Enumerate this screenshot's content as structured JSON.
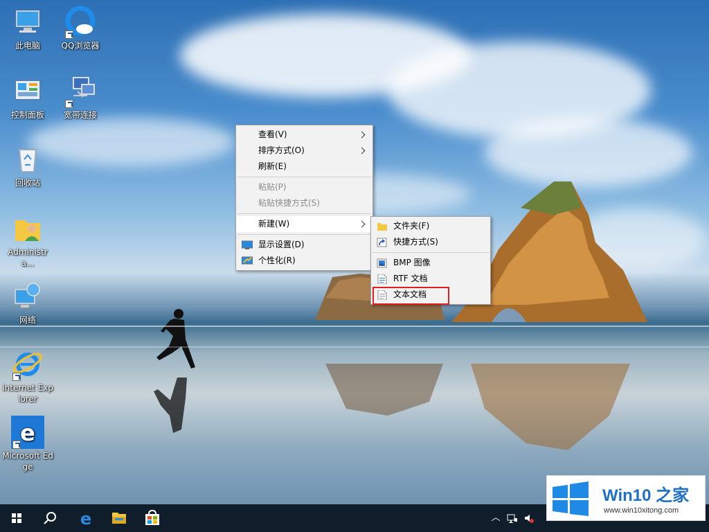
{
  "desktop": {
    "icons": [
      {
        "label": "此电脑",
        "icon": "this-pc-icon"
      },
      {
        "label": "QQ浏览器",
        "icon": "qq-browser-icon"
      },
      {
        "label": "控制面板",
        "icon": "control-panel-icon"
      },
      {
        "label": "宽带连接",
        "icon": "broadband-connection-icon"
      },
      {
        "label": "回收站",
        "icon": "recycle-bin-icon"
      },
      {
        "label": "Administra...",
        "icon": "user-folder-icon"
      },
      {
        "label": "网络",
        "icon": "network-icon"
      },
      {
        "label": "Internet Explorer",
        "icon": "internet-explorer-icon"
      },
      {
        "label": "Microsoft Edge",
        "icon": "edge-icon"
      }
    ]
  },
  "context_menu": {
    "items": [
      {
        "label": "查看(V)",
        "submenu": true
      },
      {
        "label": "排序方式(O)",
        "submenu": true
      },
      {
        "label": "刷新(E)"
      },
      {
        "label": "粘贴(P)",
        "disabled": true
      },
      {
        "label": "粘贴快捷方式(S)",
        "disabled": true
      },
      {
        "label": "新建(W)",
        "submenu": true,
        "active": true
      },
      {
        "label": "显示设置(D)",
        "icon": "display-settings-icon"
      },
      {
        "label": "个性化(R)",
        "icon": "personalize-icon"
      }
    ]
  },
  "new_submenu": {
    "items": [
      {
        "label": "文件夹(F)",
        "icon": "folder-icon"
      },
      {
        "label": "快捷方式(S)",
        "icon": "shortcut-icon"
      },
      {
        "label": "BMP 图像",
        "icon": "bmp-image-icon"
      },
      {
        "label": "RTF 文档",
        "icon": "rtf-document-icon"
      },
      {
        "label": "文本文档",
        "icon": "text-document-icon",
        "highlighted": true
      }
    ]
  },
  "taskbar": {
    "buttons": [
      "windows-start-icon",
      "search-icon",
      "edge-icon",
      "file-explorer-icon",
      "store-icon"
    ]
  },
  "watermark": {
    "title": "Win10 之家",
    "url": "www.win10xitong.com"
  },
  "colors": {
    "taskbar": "#101d2b",
    "highlight": "#e02020",
    "brand": "#1e6fc8"
  }
}
